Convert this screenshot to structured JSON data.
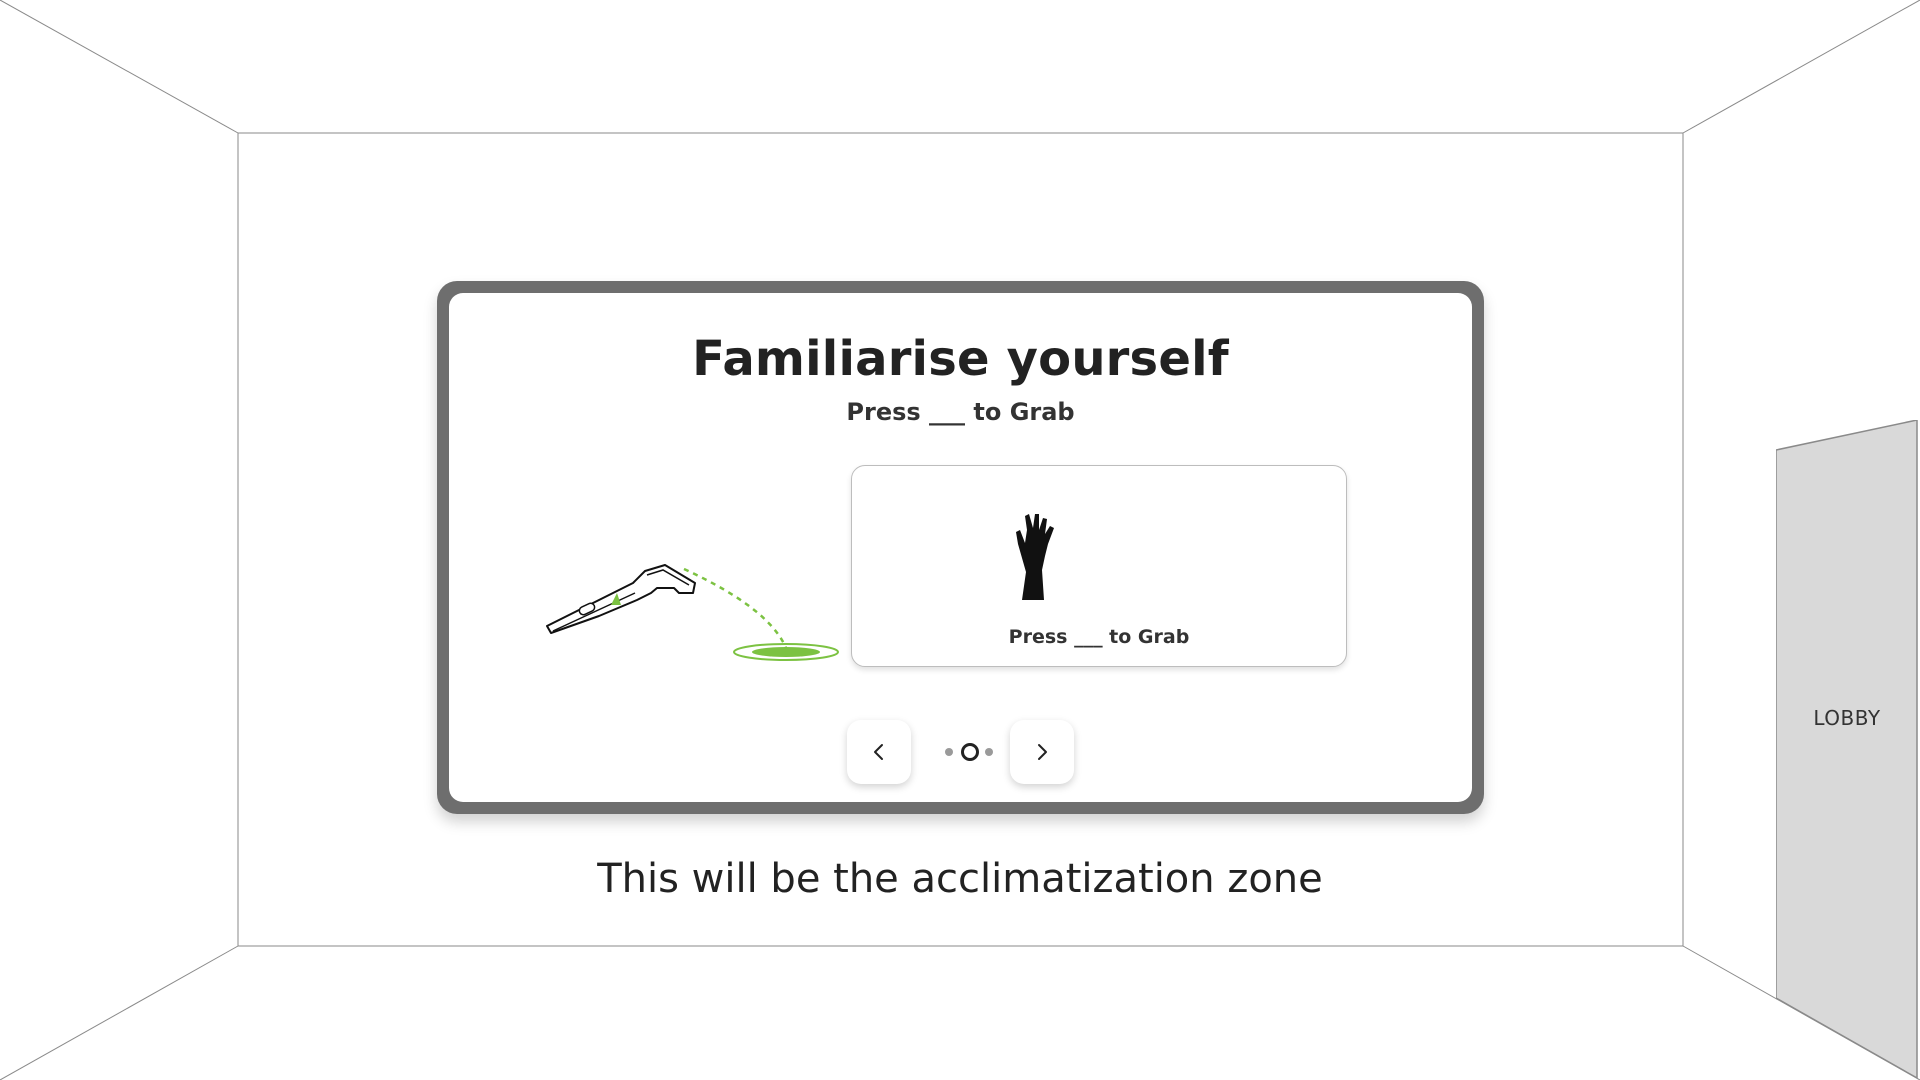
{
  "panel": {
    "title": "Familiarise yourself",
    "subtitle": "Press ___ to Grab",
    "card_caption": "Press ___ to Grab",
    "pager": {
      "total_pages": 3,
      "current_page": 2
    }
  },
  "scene": {
    "zone_caption": "This will be the acclimatization zone",
    "door_label": "LOBBY"
  },
  "colors": {
    "accent_green": "#7cc242",
    "frame_gray": "#6e6e6e",
    "door_gray": "#d9d9d9"
  },
  "icons": {
    "controller": "vr-controller-icon",
    "hand": "hand-grab-icon",
    "prev": "chevron-left-icon",
    "next": "chevron-right-icon"
  }
}
